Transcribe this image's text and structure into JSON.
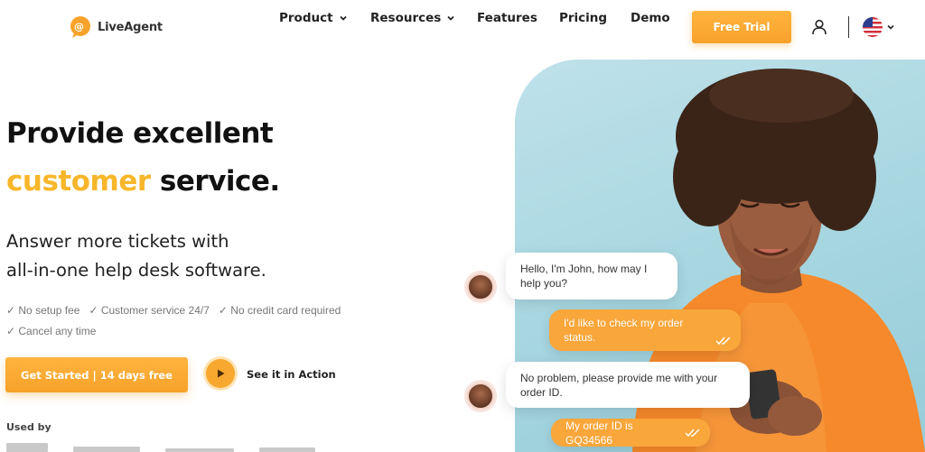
{
  "header": {
    "logo_text": "LiveAgent",
    "nav": [
      {
        "label": "Product",
        "has_dropdown": true
      },
      {
        "label": "Resources",
        "has_dropdown": true
      },
      {
        "label": "Features",
        "has_dropdown": false
      },
      {
        "label": "Pricing",
        "has_dropdown": false
      },
      {
        "label": "Demo",
        "has_dropdown": false
      }
    ],
    "cta_label": "Free Trial",
    "user_icon": "user-icon",
    "language_flag": "us-flag-icon"
  },
  "hero": {
    "title_line1": "Provide excellent",
    "title_accent": "customer",
    "title_rest": " service.",
    "subtitle_line1": "Answer more tickets with",
    "subtitle_line2": "all-in-one help desk software.",
    "checks": [
      "✓ No setup fee",
      "✓ Customer service 24/7",
      "✓ No credit card required",
      "✓ Cancel any time"
    ],
    "primary_button": "Get Started | 14 days free",
    "secondary_button": "See it in Action",
    "used_by_label": "Used by"
  },
  "chat": [
    {
      "from": "agent",
      "text": "Hello, I'm John, how may I help you?"
    },
    {
      "from": "customer",
      "text": "I'd like to check my order status."
    },
    {
      "from": "agent",
      "text": "No problem, please provide me with your order ID."
    },
    {
      "from": "customer",
      "text": "My order ID is GQ34566"
    }
  ],
  "colors": {
    "accent": "#f8b62a",
    "button": "#f7a22a",
    "photo_bg": "#a6d6e0"
  }
}
